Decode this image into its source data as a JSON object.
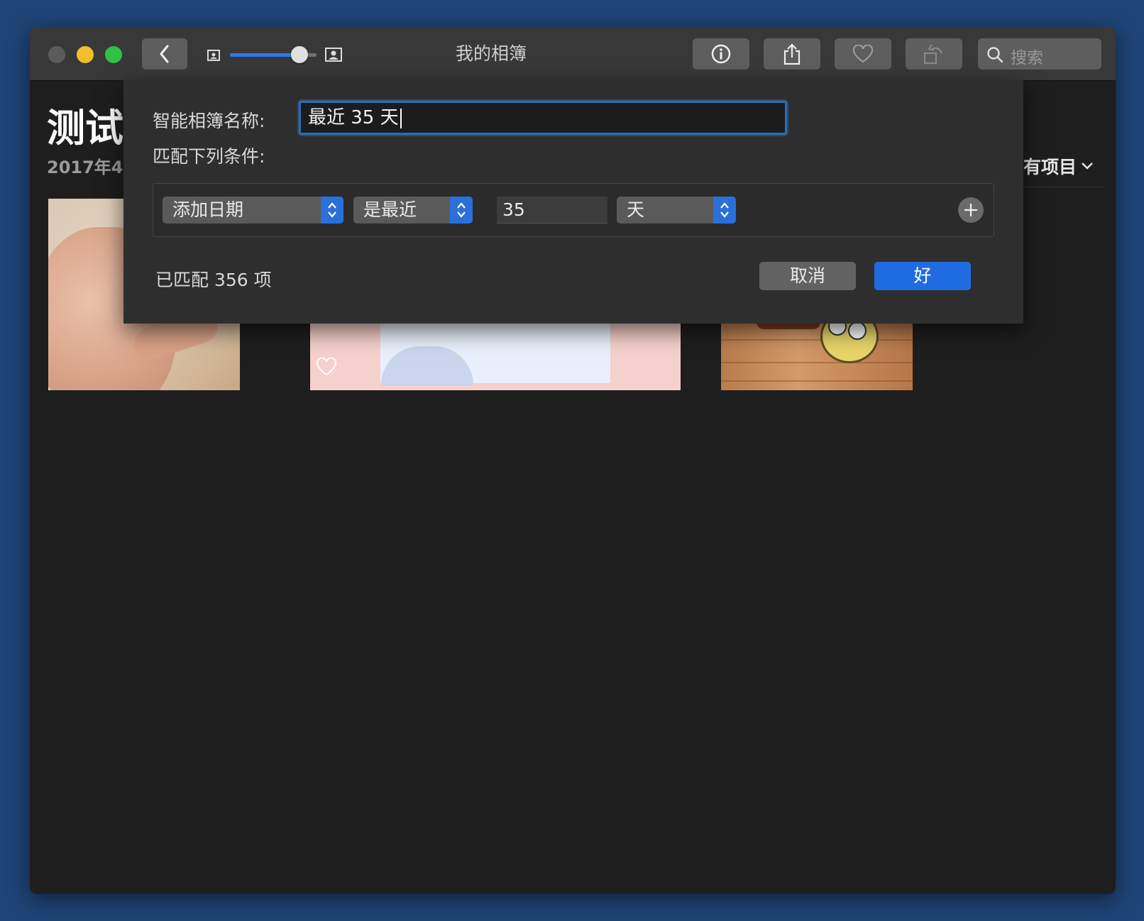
{
  "window": {
    "title": "我的相簿",
    "search_placeholder": "搜索"
  },
  "toolbar": {
    "back_icon": "chevron-left-icon",
    "zoom_slider_level": 0.8,
    "info_icon": "info-icon",
    "share_icon": "share-icon",
    "favorite_icon": "heart-icon",
    "rotate_icon": "rotate-icon",
    "search_icon": "search-icon"
  },
  "content": {
    "album_title": "测试",
    "date_range": "2017年4",
    "show_filter": "有项目"
  },
  "dialog": {
    "name_label": "智能相簿名称:",
    "name_value": "最近 35 天",
    "match_label": "匹配下列条件:",
    "rule": {
      "field": "添加日期",
      "operator": "是最近",
      "value": "35",
      "unit": "天"
    },
    "matched_text": "已匹配 356 项",
    "cancel_label": "取消",
    "ok_label": "好"
  },
  "colors": {
    "accent": "#2b6fd8",
    "desktop": "#1f4476",
    "window_bg": "#1e1e1e",
    "sheet_bg": "#2e2e2e"
  }
}
